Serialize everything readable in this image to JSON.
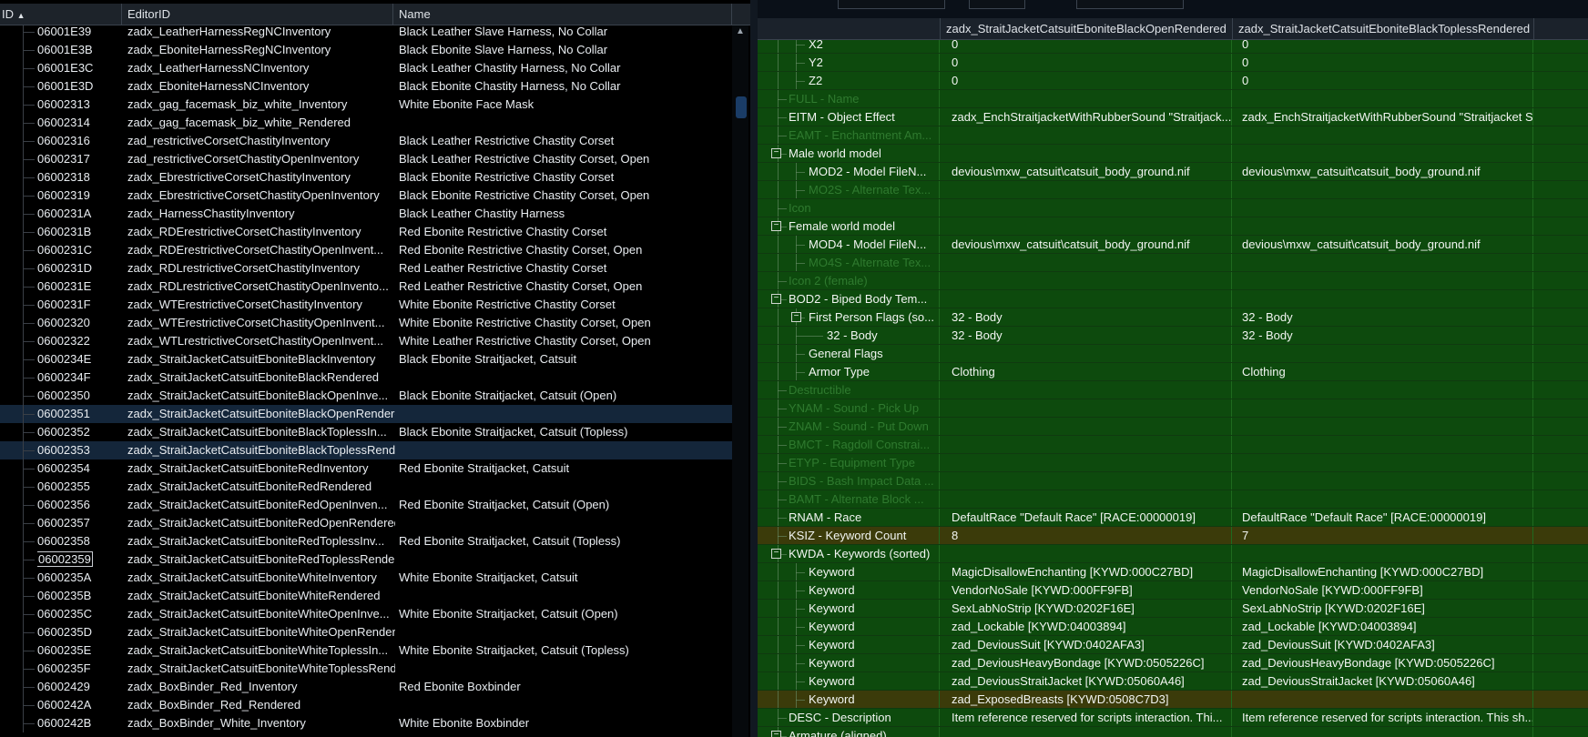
{
  "left_panel": {
    "headers": {
      "id": "ID",
      "editor_id": "EditorID",
      "name": "Name"
    },
    "rows": [
      {
        "id": "06001E39",
        "editor_id": "zadx_LeatherHarnessRegNCInventory",
        "name": "Black Leather Slave Harness, No Collar"
      },
      {
        "id": "06001E3B",
        "editor_id": "zadx_EboniteHarnessRegNCInventory",
        "name": "Black Ebonite Slave Harness, No Collar"
      },
      {
        "id": "06001E3C",
        "editor_id": "zadx_LeatherHarnessNCInventory",
        "name": "Black Leather Chastity Harness, No Collar"
      },
      {
        "id": "06001E3D",
        "editor_id": "zadx_EboniteHarnessNCInventory",
        "name": "Black Ebonite Chastity Harness, No Collar"
      },
      {
        "id": "06002313",
        "editor_id": "zadx_gag_facemask_biz_white_Inventory",
        "name": "White Ebonite Face Mask"
      },
      {
        "id": "06002314",
        "editor_id": "zadx_gag_facemask_biz_white_Rendered",
        "name": ""
      },
      {
        "id": "06002316",
        "editor_id": "zad_restrictiveCorsetChastityInventory",
        "name": "Black Leather Restrictive Chastity Corset"
      },
      {
        "id": "06002317",
        "editor_id": "zad_restrictiveCorsetChastityOpenInventory",
        "name": "Black Leather Restrictive Chastity Corset, Open"
      },
      {
        "id": "06002318",
        "editor_id": "zadx_EbrestrictiveCorsetChastityInventory",
        "name": "Black Ebonite Restrictive Chastity Corset"
      },
      {
        "id": "06002319",
        "editor_id": "zadx_EbrestrictiveCorsetChastityOpenInventory",
        "name": "Black Ebonite Restrictive Chastity Corset, Open"
      },
      {
        "id": "0600231A",
        "editor_id": "zadx_HarnessChastityInventory",
        "name": "Black Leather Chastity Harness"
      },
      {
        "id": "0600231B",
        "editor_id": "zadx_RDErestrictiveCorsetChastityInventory",
        "name": "Red Ebonite Restrictive Chastity Corset"
      },
      {
        "id": "0600231C",
        "editor_id": "zadx_RDErestrictiveCorsetChastityOpenInvent...",
        "name": "Red Ebonite Restrictive Chastity Corset, Open"
      },
      {
        "id": "0600231D",
        "editor_id": "zadx_RDLrestrictiveCorsetChastityInventory",
        "name": "Red Leather Restrictive Chastity Corset"
      },
      {
        "id": "0600231E",
        "editor_id": "zadx_RDLrestrictiveCorsetChastityOpenInvento...",
        "name": "Red Leather Restrictive Chastity Corset, Open"
      },
      {
        "id": "0600231F",
        "editor_id": "zadx_WTErestrictiveCorsetChastityInventory",
        "name": "White Ebonite Restrictive Chastity Corset"
      },
      {
        "id": "06002320",
        "editor_id": "zadx_WTErestrictiveCorsetChastityOpenInvent...",
        "name": "White Ebonite Restrictive Chastity Corset, Open"
      },
      {
        "id": "06002322",
        "editor_id": "zadx_WTLrestrictiveCorsetChastityOpenInvent...",
        "name": "White Leather Restrictive Chastity Corset, Open"
      },
      {
        "id": "0600234E",
        "editor_id": "zadx_StraitJacketCatsuitEboniteBlackInventory",
        "name": "Black Ebonite Straitjacket, Catsuit"
      },
      {
        "id": "0600234F",
        "editor_id": "zadx_StraitJacketCatsuitEboniteBlackRendered",
        "name": ""
      },
      {
        "id": "06002350",
        "editor_id": "zadx_StraitJacketCatsuitEboniteBlackOpenInve...",
        "name": "Black Ebonite Straitjacket, Catsuit (Open)"
      },
      {
        "id": "06002351",
        "editor_id": "zadx_StraitJacketCatsuitEboniteBlackOpenRendered",
        "name": ""
      },
      {
        "id": "06002352",
        "editor_id": "zadx_StraitJacketCatsuitEboniteBlackToplessIn...",
        "name": "Black Ebonite Straitjacket, Catsuit (Topless)"
      },
      {
        "id": "06002353",
        "editor_id": "zadx_StraitJacketCatsuitEboniteBlackToplessRendered",
        "name": ""
      },
      {
        "id": "06002354",
        "editor_id": "zadx_StraitJacketCatsuitEboniteRedInventory",
        "name": "Red Ebonite Straitjacket, Catsuit"
      },
      {
        "id": "06002355",
        "editor_id": "zadx_StraitJacketCatsuitEboniteRedRendered",
        "name": ""
      },
      {
        "id": "06002356",
        "editor_id": "zadx_StraitJacketCatsuitEboniteRedOpenInven...",
        "name": "Red Ebonite Straitjacket, Catsuit (Open)"
      },
      {
        "id": "06002357",
        "editor_id": "zadx_StraitJacketCatsuitEboniteRedOpenRendered",
        "name": ""
      },
      {
        "id": "06002358",
        "editor_id": "zadx_StraitJacketCatsuitEboniteRedToplessInv...",
        "name": "Red Ebonite Straitjacket, Catsuit (Topless)"
      },
      {
        "id": "06002359",
        "editor_id": "zadx_StraitJacketCatsuitEboniteRedToplessRendered",
        "name": ""
      },
      {
        "id": "0600235A",
        "editor_id": "zadx_StraitJacketCatsuitEboniteWhiteInventory",
        "name": "White Ebonite Straitjacket, Catsuit"
      },
      {
        "id": "0600235B",
        "editor_id": "zadx_StraitJacketCatsuitEboniteWhiteRendered",
        "name": ""
      },
      {
        "id": "0600235C",
        "editor_id": "zadx_StraitJacketCatsuitEboniteWhiteOpenInve...",
        "name": "White Ebonite Straitjacket, Catsuit (Open)"
      },
      {
        "id": "0600235D",
        "editor_id": "zadx_StraitJacketCatsuitEboniteWhiteOpenRendered",
        "name": ""
      },
      {
        "id": "0600235E",
        "editor_id": "zadx_StraitJacketCatsuitEboniteWhiteToplessIn...",
        "name": "White Ebonite Straitjacket, Catsuit (Topless)"
      },
      {
        "id": "0600235F",
        "editor_id": "zadx_StraitJacketCatsuitEboniteWhiteToplessRendered",
        "name": ""
      },
      {
        "id": "06002429",
        "editor_id": "zadx_BoxBinder_Red_Inventory",
        "name": "Red Ebonite Boxbinder"
      },
      {
        "id": "0600242A",
        "editor_id": "zadx_BoxBinder_Red_Rendered",
        "name": ""
      },
      {
        "id": "0600242B",
        "editor_id": "zadx_BoxBinder_White_Inventory",
        "name": "White Ebonite Boxbinder"
      }
    ]
  },
  "right_panel": {
    "column_headers": [
      "zadx_StraitJacketCatsuitEboniteBlackOpenRendered",
      "zadx_StraitJacketCatsuitEboniteBlackToplessRendered"
    ],
    "rows": [
      {
        "label": "X2",
        "v1": "0",
        "v2": "0"
      },
      {
        "label": "Y2",
        "v1": "0",
        "v2": "0"
      },
      {
        "label": "Z2",
        "v1": "0",
        "v2": "0"
      },
      {
        "label": "FULL - Name",
        "v1": "",
        "v2": ""
      },
      {
        "label": "EITM - Object Effect",
        "v1": "zadx_EnchStraitjacketWithRubberSound \"Straitjack...",
        "v2": "zadx_EnchStraitjacketWithRubberSound \"Straitjacket Sc..."
      },
      {
        "label": "EAMT - Enchantment Am...",
        "v1": "",
        "v2": ""
      },
      {
        "label": "Male world model",
        "v1": "",
        "v2": ""
      },
      {
        "label": "MOD2 - Model FileN...",
        "v1": "devious\\mxw_catsuit\\catsuit_body_ground.nif",
        "v2": "devious\\mxw_catsuit\\catsuit_body_ground.nif"
      },
      {
        "label": "MO2S - Alternate Tex...",
        "v1": "",
        "v2": ""
      },
      {
        "label": "Icon",
        "v1": "",
        "v2": ""
      },
      {
        "label": "Female world model",
        "v1": "",
        "v2": ""
      },
      {
        "label": "MOD4 - Model FileN...",
        "v1": "devious\\mxw_catsuit\\catsuit_body_ground.nif",
        "v2": "devious\\mxw_catsuit\\catsuit_body_ground.nif"
      },
      {
        "label": "MO4S - Alternate Tex...",
        "v1": "",
        "v2": ""
      },
      {
        "label": "Icon 2 (female)",
        "v1": "",
        "v2": ""
      },
      {
        "label": "BOD2 - Biped Body Tem...",
        "v1": "",
        "v2": ""
      },
      {
        "label": "First Person Flags (so...",
        "v1": "32 - Body",
        "v2": "32 - Body"
      },
      {
        "label": "32 - Body",
        "v1": "32 - Body",
        "v2": "32 - Body"
      },
      {
        "label": "General Flags",
        "v1": "",
        "v2": ""
      },
      {
        "label": "Armor Type",
        "v1": "Clothing",
        "v2": "Clothing"
      },
      {
        "label": "Destructible",
        "v1": "",
        "v2": ""
      },
      {
        "label": "YNAM - Sound - Pick Up",
        "v1": "",
        "v2": ""
      },
      {
        "label": "ZNAM - Sound - Put Down",
        "v1": "",
        "v2": ""
      },
      {
        "label": "BMCT - Ragdoll Constrai...",
        "v1": "",
        "v2": ""
      },
      {
        "label": "ETYP - Equipment Type",
        "v1": "",
        "v2": ""
      },
      {
        "label": "BIDS - Bash Impact Data ...",
        "v1": "",
        "v2": ""
      },
      {
        "label": "BAMT - Alternate Block ...",
        "v1": "",
        "v2": ""
      },
      {
        "label": "RNAM - Race",
        "v1": "DefaultRace \"Default Race\" [RACE:00000019]",
        "v2": "DefaultRace \"Default Race\" [RACE:00000019]"
      },
      {
        "label": "KSIZ - Keyword Count",
        "v1": "8",
        "v2": "7"
      },
      {
        "label": "KWDA - Keywords (sorted)",
        "v1": "",
        "v2": ""
      },
      {
        "label": "Keyword",
        "v1": "MagicDisallowEnchanting [KYWD:000C27BD]",
        "v2": "MagicDisallowEnchanting [KYWD:000C27BD]"
      },
      {
        "label": "Keyword",
        "v1": "VendorNoSale [KYWD:000FF9FB]",
        "v2": "VendorNoSale [KYWD:000FF9FB]"
      },
      {
        "label": "Keyword",
        "v1": "SexLabNoStrip [KYWD:0202F16E]",
        "v2": "SexLabNoStrip [KYWD:0202F16E]"
      },
      {
        "label": "Keyword",
        "v1": "zad_Lockable [KYWD:04003894]",
        "v2": "zad_Lockable [KYWD:04003894]"
      },
      {
        "label": "Keyword",
        "v1": "zad_DeviousSuit [KYWD:0402AFA3]",
        "v2": "zad_DeviousSuit [KYWD:0402AFA3]"
      },
      {
        "label": "Keyword",
        "v1": "zad_DeviousHeavyBondage [KYWD:0505226C]",
        "v2": "zad_DeviousHeavyBondage [KYWD:0505226C]"
      },
      {
        "label": "Keyword",
        "v1": "zad_DeviousStraitJacket [KYWD:05060A46]",
        "v2": "zad_DeviousStraitJacket [KYWD:05060A46]"
      },
      {
        "label": "Keyword",
        "v1": "zad_ExposedBreasts [KYWD:0508C7D3]",
        "v2": ""
      },
      {
        "label": "DESC - Description",
        "v1": "Item reference reserved for scripts interaction. Thi...",
        "v2": "Item reference reserved for scripts interaction. This sh..."
      },
      {
        "label": "Armature (aligned)",
        "v1": "",
        "v2": ""
      }
    ]
  },
  "colors": {
    "row_green": "#0d4a0d",
    "row_yellow": "#3b3b0a",
    "selection": "#14263a"
  }
}
